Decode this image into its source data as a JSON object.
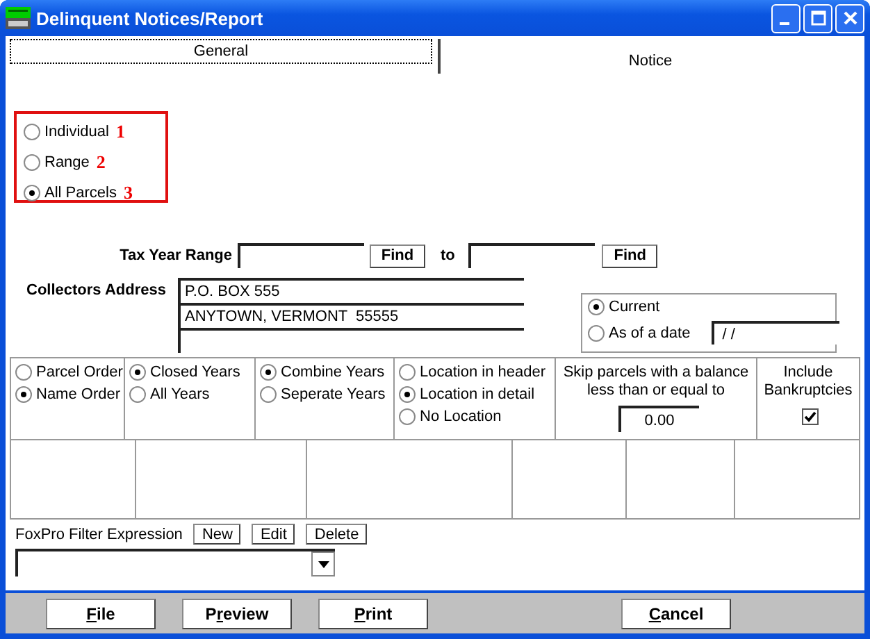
{
  "window": {
    "title": "Delinquent Notices/Report"
  },
  "tabs": [
    {
      "label": "General",
      "selected": true
    },
    {
      "label": "Notice",
      "selected": false
    }
  ],
  "selection_group": [
    {
      "label": "Individual",
      "number": "1",
      "selected": false
    },
    {
      "label": "Range",
      "number": "2",
      "selected": false
    },
    {
      "label": "All Parcels",
      "number": "3",
      "selected": true
    }
  ],
  "tax_year_range": {
    "label": "Tax Year Range",
    "find_button": "Find",
    "to_label": "to",
    "second_find_button": "Find"
  },
  "collectors_address": {
    "label": "Collectors Address",
    "lines": [
      "P.O. BOX 555",
      "ANYTOWN, VERMONT  55555"
    ]
  },
  "date_option": [
    {
      "label": "Current",
      "selected": true
    },
    {
      "label": "As of a date",
      "selected": false,
      "value": " / /"
    }
  ],
  "options": [
    {
      "kind": "radio_group",
      "items": [
        {
          "label": "Parcel Order",
          "selected": false
        },
        {
          "label": "Name Order",
          "selected": true
        }
      ]
    },
    {
      "kind": "radio_group",
      "items": [
        {
          "label": "Closed Years",
          "selected": true
        },
        {
          "label": "All Years",
          "selected": false
        }
      ]
    },
    {
      "kind": "radio_group",
      "items": [
        {
          "label": "Combine Years",
          "selected": true
        },
        {
          "label": "Seperate Years",
          "selected": false
        }
      ]
    },
    {
      "kind": "radio_group",
      "items": [
        {
          "label": "Location in header",
          "selected": false
        },
        {
          "label": "Location in detail",
          "selected": true
        },
        {
          "label": "No Location",
          "selected": false
        }
      ]
    },
    {
      "kind": "balance",
      "label": "Skip parcels with a balance less than or equal to",
      "value": "0.00"
    },
    {
      "kind": "checkbox",
      "label": "Include Bankruptcies",
      "checked": true
    }
  ],
  "filter": {
    "label": "FoxPro Filter Expression",
    "buttons": [
      "New",
      "Edit",
      "Delete"
    ]
  },
  "footer_buttons": [
    {
      "key": "F",
      "after": "ile"
    },
    {
      "before": "P",
      "key": "r",
      "after": "eview"
    },
    {
      "key": "P",
      "after": "rint"
    },
    {
      "key": "C",
      "after": "ancel"
    }
  ]
}
